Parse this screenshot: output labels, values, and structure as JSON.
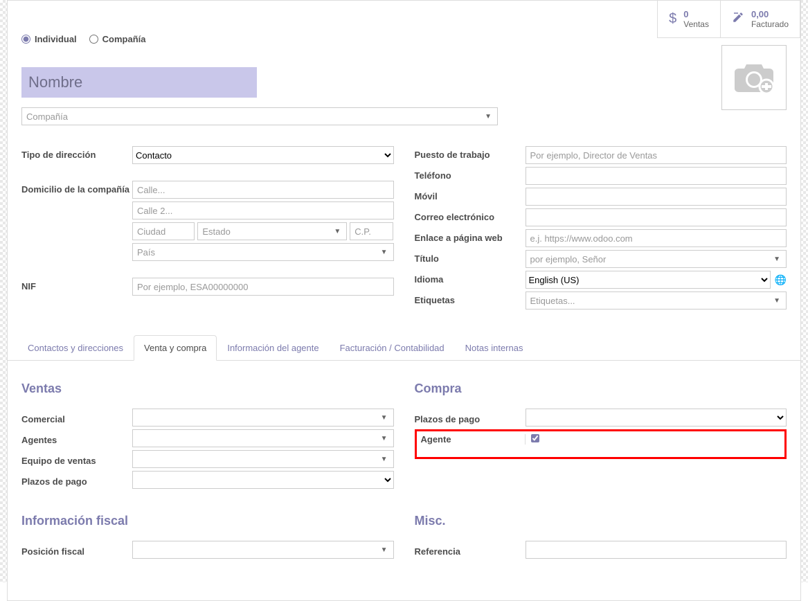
{
  "stats": {
    "ventas": {
      "value": "0",
      "label": "Ventas"
    },
    "facturado": {
      "value": "0,00",
      "label": "Facturado"
    }
  },
  "type_radios": {
    "individual": "Individual",
    "compania": "Compañía"
  },
  "name_placeholder": "Nombre",
  "company_placeholder": "Compañía",
  "left_fields": {
    "tipo_direccion_label": "Tipo de dirección",
    "tipo_direccion_value": "Contacto",
    "domicilio_label": "Domicilio de la compañía",
    "calle_placeholder": "Calle...",
    "calle2_placeholder": "Calle 2...",
    "ciudad_placeholder": "Ciudad",
    "estado_placeholder": "Estado",
    "cp_placeholder": "C.P.",
    "pais_placeholder": "País",
    "nif_label": "NIF",
    "nif_placeholder": "Por ejemplo, ESA00000000"
  },
  "right_fields": {
    "puesto_label": "Puesto de trabajo",
    "puesto_placeholder": "Por ejemplo, Director de Ventas",
    "telefono_label": "Teléfono",
    "movil_label": "Móvil",
    "correo_label": "Correo electrónico",
    "web_label": "Enlace a página web",
    "web_placeholder": "e.j. https://www.odoo.com",
    "titulo_label": "Título",
    "titulo_placeholder": "por ejemplo, Señor",
    "idioma_label": "Idioma",
    "idioma_value": "English (US)",
    "etiquetas_label": "Etiquetas",
    "etiquetas_placeholder": "Etiquetas..."
  },
  "tabs": {
    "contactos": "Contactos y direcciones",
    "venta_compra": "Venta y compra",
    "info_agente": "Información del agente",
    "facturacion": "Facturación / Contabilidad",
    "notas": "Notas internas"
  },
  "venta_compra_tab": {
    "ventas_title": "Ventas",
    "compra_title": "Compra",
    "comercial_label": "Comercial",
    "agentes_label": "Agentes",
    "equipo_ventas_label": "Equipo de ventas",
    "plazos_pago_label": "Plazos de pago",
    "plazos_pago_compra_label": "Plazos de pago",
    "agente_label": "Agente",
    "info_fiscal_title": "Información fiscal",
    "posicion_fiscal_label": "Posición fiscal",
    "misc_title": "Misc.",
    "referencia_label": "Referencia"
  }
}
